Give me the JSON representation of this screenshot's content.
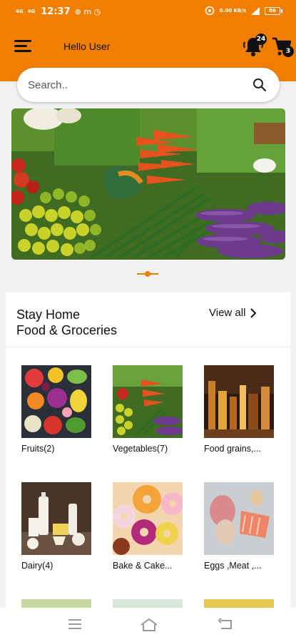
{
  "status_bar": {
    "time": "12:37",
    "signal_1": "4G",
    "signal_2": "4G",
    "notif_icons": "⊕ m ◷",
    "data_speed": "0.00 KB/s",
    "battery": "86"
  },
  "header": {
    "greeting": "Hello User",
    "notification_count": "24",
    "cart_count": "3",
    "accent": "#f07f00"
  },
  "search": {
    "placeholder": "Search.."
  },
  "banner": {
    "alt": "Fresh vegetables",
    "slides": 1
  },
  "categories_section": {
    "title_line1": "Stay Home",
    "title_line2": "Food & Groceries",
    "view_all": "View all",
    "items": [
      {
        "label": "Fruits(2)"
      },
      {
        "label": "Vegetables(7)"
      },
      {
        "label": "Food grains,..."
      },
      {
        "label": "Dairy(4)"
      },
      {
        "label": "Bake & Cake..."
      },
      {
        "label": "Eggs ,Meat ,..."
      }
    ]
  },
  "bottom_nav": {
    "icons": [
      "menu-icon",
      "home-icon",
      "back-icon"
    ]
  }
}
